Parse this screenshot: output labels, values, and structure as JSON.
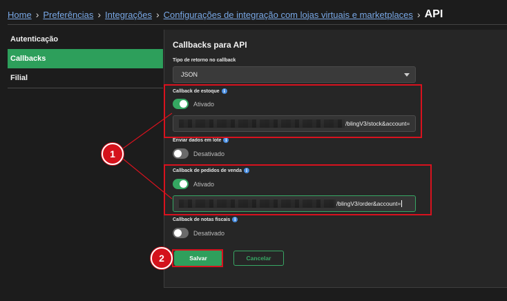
{
  "breadcrumb": {
    "items": [
      "Home",
      "Preferências",
      "Integrações",
      "Configurações de integração com lojas virtuais e marketplaces"
    ],
    "current": "API"
  },
  "sidebar": {
    "items": [
      {
        "label": "Autenticação",
        "active": false
      },
      {
        "label": "Callbacks",
        "active": true
      },
      {
        "label": "Filial",
        "active": false
      }
    ]
  },
  "main": {
    "title": "Callbacks para API",
    "return_type": {
      "label": "Tipo de retorno no callback",
      "value": "JSON"
    },
    "stock_callback": {
      "label": "Callback de estoque",
      "toggle": "Ativado",
      "enabled": true,
      "url_suffix": "/blingV3/stock&account="
    },
    "batch": {
      "label": "Enviar dados em lote",
      "toggle": "Desativado",
      "enabled": false
    },
    "orders_callback": {
      "label": "Callback de pedidos de venda",
      "toggle": "Ativado",
      "enabled": true,
      "url_suffix": "/blingV3/order&account="
    },
    "invoices_callback": {
      "label": "Callback de notas fiscais",
      "toggle": "Desativado",
      "enabled": false
    },
    "save_label": "Salvar",
    "cancel_label": "Cancelar"
  },
  "annotations": {
    "badge1": "1",
    "badge2": "2",
    "color": "#d9121e"
  },
  "colors": {
    "accent": "#2d9f5b",
    "link": "#79a8e6",
    "background": "#1c1c1c"
  }
}
